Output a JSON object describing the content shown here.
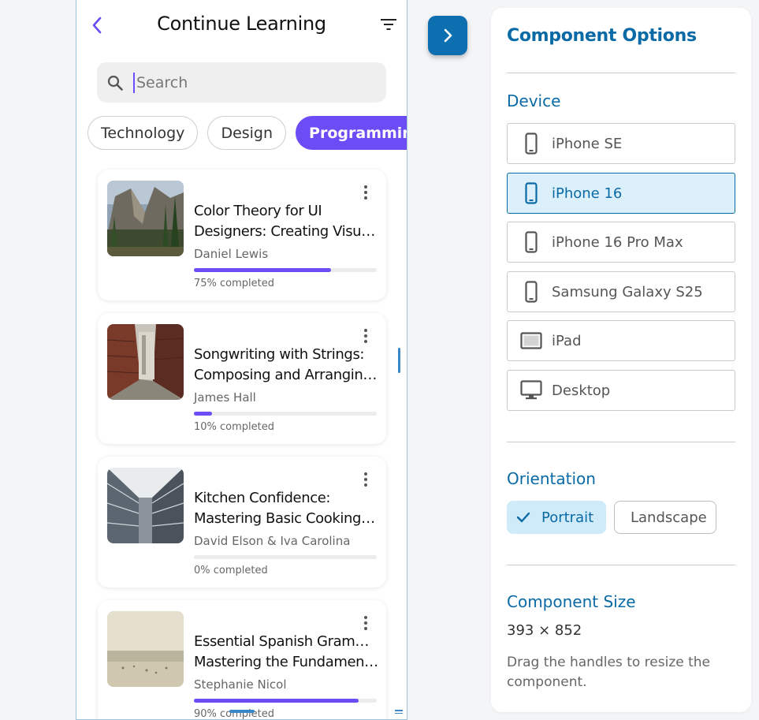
{
  "app": {
    "header": {
      "title": "Continue Learning"
    },
    "search": {
      "placeholder": "Search"
    },
    "chips": [
      {
        "label": "Technology",
        "active": false
      },
      {
        "label": "Design",
        "active": false
      },
      {
        "label": "Programming",
        "active": true
      }
    ],
    "courses": [
      {
        "title_line1": "Color Theory for UI",
        "title_line2": "Designers: Creating Visually Appealing Interfaces",
        "author": "Daniel Lewis",
        "progress": 0.75,
        "progress_label": "75% completed",
        "thumb": "mountain-landscape"
      },
      {
        "title_line1": "Songwriting with Strings:",
        "title_line2": "Composing and Arranging for Guitar",
        "author": "James Hall",
        "progress": 0.1,
        "progress_label": "10% completed",
        "thumb": "brick-alley"
      },
      {
        "title_line1": "Kitchen Confidence:",
        "title_line2": "Mastering Basic Cooking Techniques",
        "author": "David Elson & Iva Carolina",
        "progress": 0.0,
        "progress_label": "0% completed",
        "thumb": "skyscraper"
      },
      {
        "title_line1": "Essential Spanish Grammar:",
        "title_line2": "Mastering the Fundamentals",
        "author": "Stephanie Nicol",
        "progress": 0.9,
        "progress_label": "90% completed",
        "thumb": "beach"
      }
    ]
  },
  "panel": {
    "title": "Component Options",
    "device_section": "Device",
    "devices": [
      {
        "label": "iPhone SE",
        "icon": "phone-icon",
        "active": false
      },
      {
        "label": "iPhone 16",
        "icon": "phone-icon",
        "active": true
      },
      {
        "label": "iPhone 16 Pro Max",
        "icon": "phone-icon",
        "active": false
      },
      {
        "label": "Samsung Galaxy S25",
        "icon": "phone-icon",
        "active": false
      },
      {
        "label": "iPad",
        "icon": "tablet-icon",
        "active": false
      },
      {
        "label": "Desktop",
        "icon": "desktop-icon",
        "active": false
      }
    ],
    "orientation_section": "Orientation",
    "orientation": {
      "portrait": "Portrait",
      "landscape": "Landscape",
      "selected": "portrait"
    },
    "size_section": "Component Size",
    "size_value": "393 × 852",
    "size_help": "Drag the handles to resize the component."
  },
  "colors": {
    "accent": "#6c4cf5",
    "panel_blue": "#0a6aa6",
    "toggle_blue": "#0d6fb0"
  }
}
